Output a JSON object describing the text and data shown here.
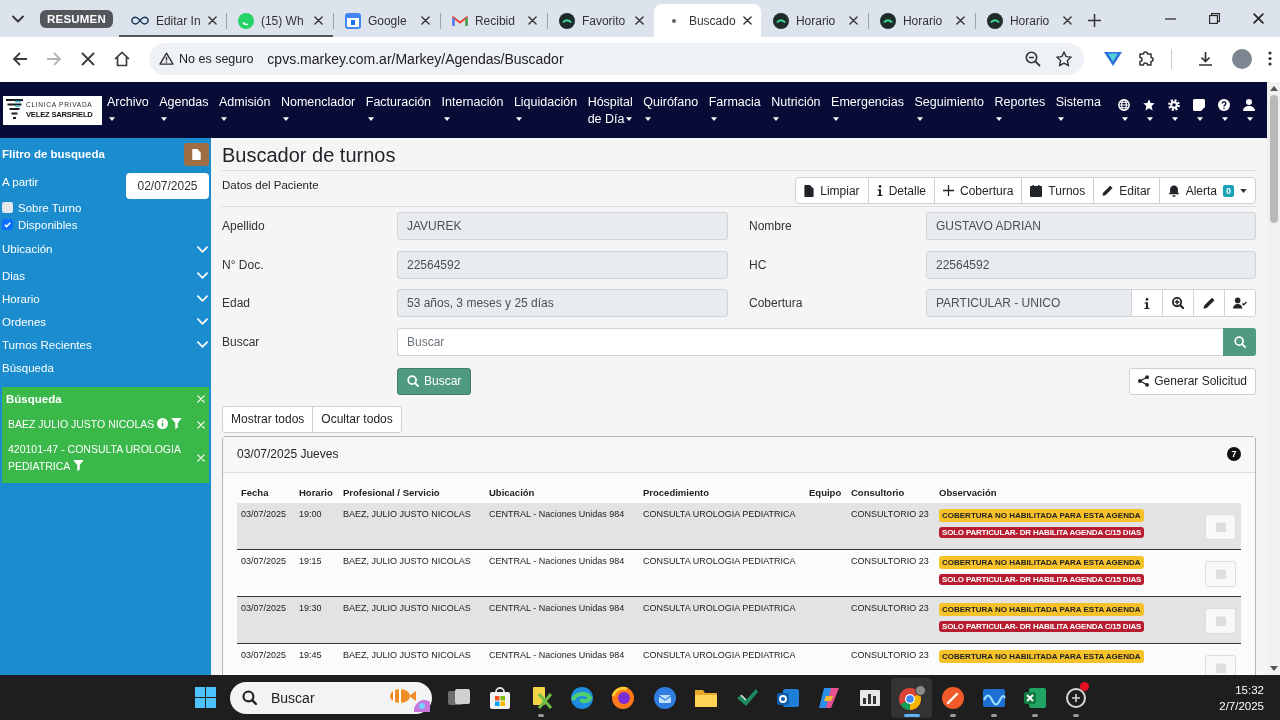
{
  "browser": {
    "tab_group": {
      "label": "RESUMEN"
    },
    "tabs": [
      {
        "title": "Editar In",
        "kind": "meta",
        "in_group": true,
        "selected": false
      },
      {
        "title": "(15) Wh",
        "kind": "chat",
        "in_group": true,
        "selected": false
      },
      {
        "title": "Google",
        "kind": "calendar",
        "in_group": false,
        "selected": false
      },
      {
        "title": "Recibid",
        "kind": "mail",
        "in_group": false,
        "selected": false
      },
      {
        "title": "Favorito",
        "kind": "site",
        "in_group": false,
        "selected": false
      },
      {
        "title": "Buscado",
        "kind": "loading",
        "in_group": false,
        "selected": true
      },
      {
        "title": "Horario",
        "kind": "site",
        "in_group": false,
        "selected": false
      },
      {
        "title": "Horario",
        "kind": "site",
        "in_group": false,
        "selected": false
      },
      {
        "title": "Horario",
        "kind": "site",
        "in_group": false,
        "selected": false
      }
    ],
    "address_bar": {
      "security": "No es seguro",
      "url": "cpvs.markey.com.ar/Markey/Agendas/Buscador",
      "loading": true,
      "forward_disabled": true
    }
  },
  "navbar": {
    "logo": {
      "subtitle": "CLINICA PRIVADA",
      "title": "VELEZ SARSFIELD"
    },
    "menu": [
      "Archivo",
      "Agendas",
      "Admisión",
      "Nomenclador",
      "Facturación",
      "Internación",
      "Liquidación",
      "Hóspital de Día",
      "Quirófano",
      "Farmacia",
      "Nutrición",
      "Emergencias",
      "Seguimiento",
      "Reportes",
      "Sistema"
    ]
  },
  "sidebar": {
    "title": "Flitro de busqueda",
    "from": {
      "label": "A partir",
      "value": "02/07/2025"
    },
    "options": [
      {
        "label": "Sobre Turno",
        "checked": false
      },
      {
        "label": "Disponibles",
        "checked": true
      }
    ],
    "sections": [
      {
        "label": "Ubicación",
        "expanded": false
      },
      {
        "label": "Dias",
        "expanded": false
      },
      {
        "label": "Horario",
        "expanded": false
      },
      {
        "label": "Ordenes",
        "expanded": false
      },
      {
        "label": "Turnos Recientes",
        "expanded": false
      }
    ],
    "search_heading": "Búsqueda",
    "search_panel": {
      "title": "Búsqueda",
      "filters": [
        {
          "label": "BAEZ JULIO JUSTO NICOLAS",
          "info": true
        },
        {
          "label": "420101-47 - CONSULTA UROLOGIA PEDIATRICA",
          "info": false
        }
      ]
    }
  },
  "main": {
    "title": "Buscador de turnos",
    "patient": {
      "heading": "Datos del Paciente",
      "actions": [
        {
          "label": "Limpiar",
          "kind": "file"
        },
        {
          "label": "Detalle",
          "kind": "info"
        },
        {
          "label": "Cobertura",
          "kind": "plus"
        },
        {
          "label": "Turnos",
          "kind": "calendar"
        },
        {
          "label": "Editar",
          "kind": "pencil"
        },
        {
          "label": "Alerta",
          "kind": "alert",
          "badge": "0"
        }
      ],
      "fields": [
        {
          "label": "Apellido",
          "value": "JAVUREK",
          "kind": "text"
        },
        {
          "label": "Nombre",
          "value": "GUSTAVO ADRIAN",
          "kind": "text"
        },
        {
          "label": "N° Doc.",
          "value": "22564592",
          "kind": "text"
        },
        {
          "label": "HC",
          "value": "22564592",
          "kind": "text"
        },
        {
          "label": "Edad",
          "value": "53 años, 3 meses y 25 días",
          "kind": "text"
        },
        {
          "label": "Cobertura",
          "value": "PARTICULAR - UNICO",
          "kind": "coverage"
        }
      ]
    },
    "search": {
      "label": "Buscar",
      "placeholder": "Buscar",
      "button": "Buscar"
    },
    "request_button": "Generar Solicitud",
    "toggles": [
      "Mostrar todos",
      "Ocultar todos"
    ],
    "results": {
      "heading": "03/07/2025 Jueves",
      "count": "7",
      "columns": [
        "Fecha",
        "Horario",
        "Profesional / Servicio",
        "Ubicación",
        "Procedimiento",
        "Equipo",
        "Consultorio",
        "Observación"
      ],
      "rows": [
        {
          "date": "03/07/2025",
          "time": "19:00",
          "professional": "BAEZ, JULIO JUSTO NICOLAS",
          "location": "CENTRAL - Naciones Unidas 984",
          "procedure": "CONSULTA UROLOGIA PEDIATRICA",
          "room": "CONSULTORIO 23",
          "notes": [
            {
              "text": "COBERTURA NO HABILITADA PARA ESTA AGENDA",
              "kind": "warning"
            },
            {
              "text": "SOLO PARTICULAR- DR HABILITA AGENDA C/15 DIAS",
              "kind": "danger"
            }
          ],
          "booking_disabled": true
        },
        {
          "date": "03/07/2025",
          "time": "19:15",
          "professional": "BAEZ, JULIO JUSTO NICOLAS",
          "location": "CENTRAL - Naciones Unidas 984",
          "procedure": "CONSULTA UROLOGIA PEDIATRICA",
          "room": "CONSULTORIO 23",
          "notes": [
            {
              "text": "COBERTURA NO HABILITADA PARA ESTA AGENDA",
              "kind": "warning"
            },
            {
              "text": "SOLO PARTICULAR- DR HABILITA AGENDA C/15 DIAS",
              "kind": "danger"
            }
          ],
          "booking_disabled": true
        },
        {
          "date": "03/07/2025",
          "time": "19:30",
          "professional": "BAEZ, JULIO JUSTO NICOLAS",
          "location": "CENTRAL - Naciones Unidas 984",
          "procedure": "CONSULTA UROLOGIA PEDIATRICA",
          "room": "CONSULTORIO 23",
          "notes": [
            {
              "text": "COBERTURA NO HABILITADA PARA ESTA AGENDA",
              "kind": "warning"
            },
            {
              "text": "SOLO PARTICULAR- DR HABILITA AGENDA C/15 DIAS",
              "kind": "danger"
            }
          ],
          "booking_disabled": true
        },
        {
          "date": "03/07/2025",
          "time": "19:45",
          "professional": "BAEZ, JULIO JUSTO NICOLAS",
          "location": "CENTRAL - Naciones Unidas 984",
          "procedure": "CONSULTA UROLOGIA PEDIATRICA",
          "room": "CONSULTORIO 23",
          "notes": [
            {
              "text": "COBERTURA NO HABILITADA PARA ESTA AGENDA",
              "kind": "warning"
            }
          ],
          "booking_disabled": true
        }
      ]
    }
  },
  "taskbar": {
    "search": {
      "placeholder": "Buscar"
    },
    "apps": [
      {
        "kind": "taskview",
        "running": false,
        "selected": false,
        "notified": false
      },
      {
        "kind": "store",
        "running": false,
        "selected": false,
        "notified": false
      },
      {
        "kind": "tools",
        "running": true,
        "selected": false,
        "notified": false
      },
      {
        "kind": "edge",
        "running": false,
        "selected": false,
        "notified": false
      },
      {
        "kind": "firefox",
        "running": false,
        "selected": false,
        "notified": false
      },
      {
        "kind": "thunderbird",
        "running": false,
        "selected": false,
        "notified": false
      },
      {
        "kind": "explorer",
        "running": false,
        "selected": false,
        "notified": false
      },
      {
        "kind": "check",
        "running": false,
        "selected": false,
        "notified": false
      },
      {
        "kind": "outlook",
        "running": false,
        "selected": false,
        "notified": false
      },
      {
        "kind": "copilot",
        "running": false,
        "selected": false,
        "notified": false
      },
      {
        "kind": "chart",
        "running": false,
        "selected": false,
        "notified": false
      },
      {
        "kind": "chrome",
        "running": true,
        "selected": true,
        "notified": false
      },
      {
        "kind": "pen",
        "running": true,
        "selected": false,
        "notified": false
      },
      {
        "kind": "wave",
        "running": true,
        "selected": false,
        "notified": false
      },
      {
        "kind": "excel",
        "running": true,
        "selected": false,
        "notified": false
      },
      {
        "kind": "ring",
        "running": true,
        "selected": false,
        "notified": true
      }
    ],
    "time": "15:32",
    "date": "2/7/2025"
  }
}
